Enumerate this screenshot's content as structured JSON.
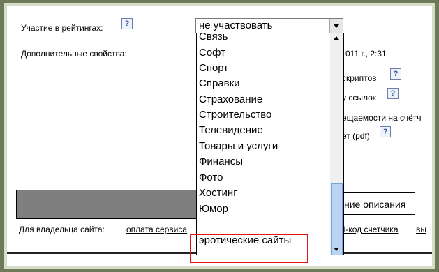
{
  "rating": {
    "label": "Участие в рейтингах:",
    "selected": "не участвовать"
  },
  "extra_props": {
    "label": "Дополнительные свойства:",
    "date_fragment": "011 г., 2:31"
  },
  "right_fragments": {
    "scripts": "скриптов",
    "links": "у ссылок",
    "visits": "ещаемости на счётч",
    "pdf": "ет (pdf)"
  },
  "dropdown": {
    "items": [
      "Связь",
      "Софт",
      "Спорт",
      "Справки",
      "Страхование",
      "Строительство",
      "Телевидение",
      "Товары и услуги",
      "Финансы",
      "Фото",
      "Хостинг",
      "Юмор",
      "эротические сайты"
    ]
  },
  "description": {
    "label": "ние описания"
  },
  "footer": {
    "owner_label": "Для владельца сайта:",
    "link_payment": "оплата сервиса",
    "link_code": "il-код счетчика",
    "link_more": "вы"
  },
  "help_icon_text": "?"
}
